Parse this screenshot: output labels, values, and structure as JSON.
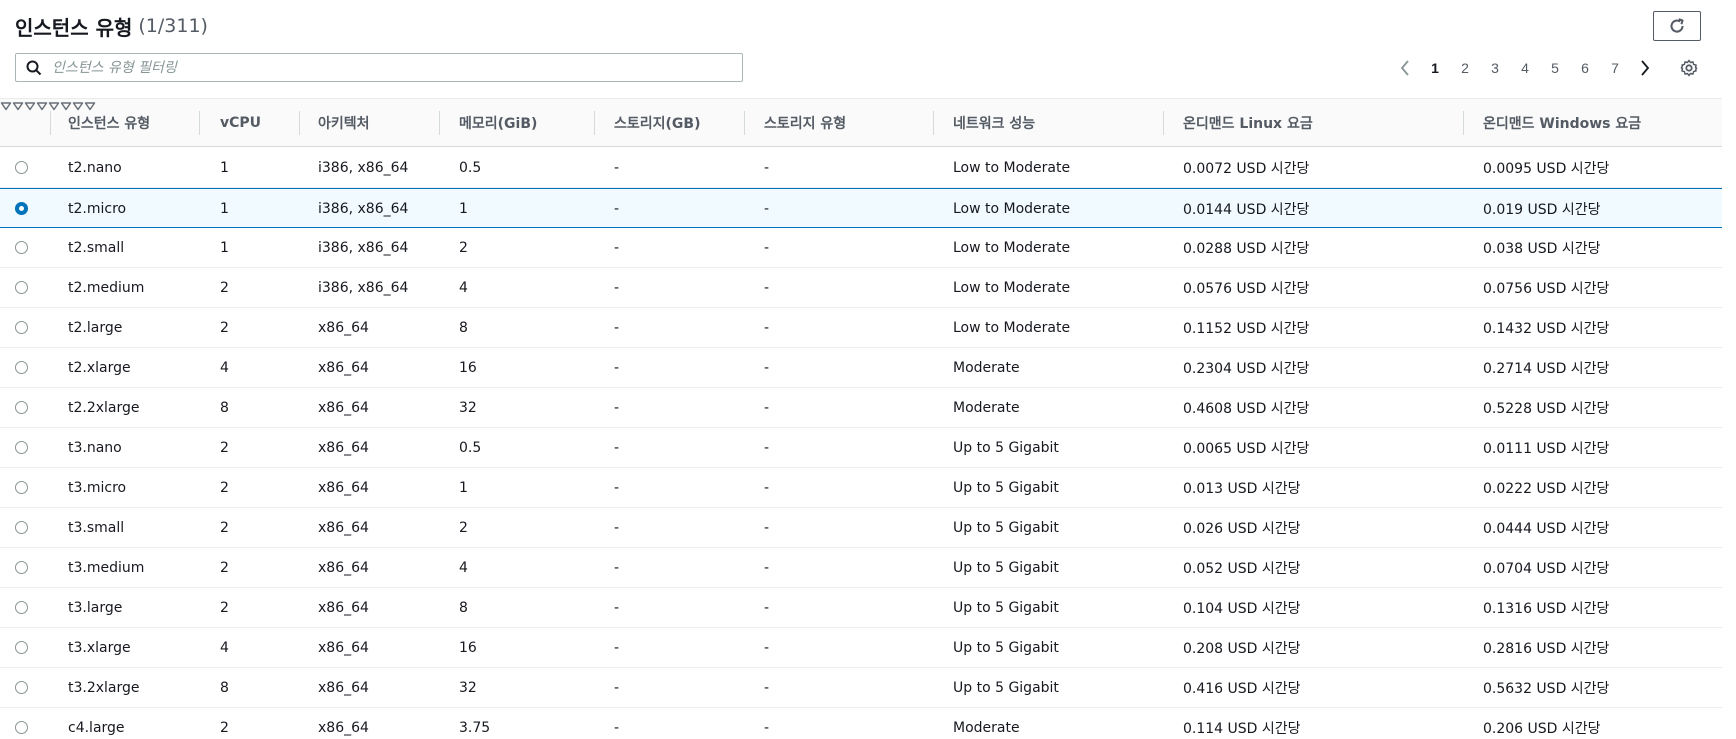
{
  "header": {
    "title": "인스턴스 유형",
    "count": "(1/311)"
  },
  "search": {
    "placeholder": "인스턴스 유형 필터링",
    "value": ""
  },
  "pagination": {
    "pages": [
      "1",
      "2",
      "3",
      "4",
      "5",
      "6",
      "7"
    ],
    "current": "1"
  },
  "icons": {
    "refresh": "refresh-icon",
    "search": "search-icon",
    "prev": "chevron-left-icon",
    "next": "chevron-right-icon",
    "settings": "gear-icon",
    "sort": "sort-down-icon"
  },
  "colors": {
    "accent": "#0073bb",
    "selected_row_bg": "#f1faff",
    "header_bg": "#fafafa"
  },
  "table": {
    "columns": [
      {
        "key": "type",
        "label": "인스턴스 유형"
      },
      {
        "key": "vcpu",
        "label": "vCPU"
      },
      {
        "key": "arch",
        "label": "아키텍처"
      },
      {
        "key": "mem",
        "label": "메모리(GiB)"
      },
      {
        "key": "storage",
        "label": "스토리지(GB)"
      },
      {
        "key": "storage_type",
        "label": "스토리지 유형"
      },
      {
        "key": "network",
        "label": "네트워크 성능"
      },
      {
        "key": "linux",
        "label": "온디맨드 Linux 요금"
      },
      {
        "key": "windows",
        "label": "온디맨드 Windows 요금"
      }
    ],
    "selected_index": 1,
    "rows": [
      {
        "type": "t2.nano",
        "vcpu": "1",
        "arch": "i386, x86_64",
        "mem": "0.5",
        "storage": "-",
        "storage_type": "-",
        "network": "Low to Moderate",
        "linux": "0.0072 USD 시간당",
        "windows": "0.0095 USD 시간당"
      },
      {
        "type": "t2.micro",
        "vcpu": "1",
        "arch": "i386, x86_64",
        "mem": "1",
        "storage": "-",
        "storage_type": "-",
        "network": "Low to Moderate",
        "linux": "0.0144 USD 시간당",
        "windows": "0.019 USD 시간당"
      },
      {
        "type": "t2.small",
        "vcpu": "1",
        "arch": "i386, x86_64",
        "mem": "2",
        "storage": "-",
        "storage_type": "-",
        "network": "Low to Moderate",
        "linux": "0.0288 USD 시간당",
        "windows": "0.038 USD 시간당"
      },
      {
        "type": "t2.medium",
        "vcpu": "2",
        "arch": "i386, x86_64",
        "mem": "4",
        "storage": "-",
        "storage_type": "-",
        "network": "Low to Moderate",
        "linux": "0.0576 USD 시간당",
        "windows": "0.0756 USD 시간당"
      },
      {
        "type": "t2.large",
        "vcpu": "2",
        "arch": "x86_64",
        "mem": "8",
        "storage": "-",
        "storage_type": "-",
        "network": "Low to Moderate",
        "linux": "0.1152 USD 시간당",
        "windows": "0.1432 USD 시간당"
      },
      {
        "type": "t2.xlarge",
        "vcpu": "4",
        "arch": "x86_64",
        "mem": "16",
        "storage": "-",
        "storage_type": "-",
        "network": "Moderate",
        "linux": "0.2304 USD 시간당",
        "windows": "0.2714 USD 시간당"
      },
      {
        "type": "t2.2xlarge",
        "vcpu": "8",
        "arch": "x86_64",
        "mem": "32",
        "storage": "-",
        "storage_type": "-",
        "network": "Moderate",
        "linux": "0.4608 USD 시간당",
        "windows": "0.5228 USD 시간당"
      },
      {
        "type": "t3.nano",
        "vcpu": "2",
        "arch": "x86_64",
        "mem": "0.5",
        "storage": "-",
        "storage_type": "-",
        "network": "Up to 5 Gigabit",
        "linux": "0.0065 USD 시간당",
        "windows": "0.0111 USD 시간당"
      },
      {
        "type": "t3.micro",
        "vcpu": "2",
        "arch": "x86_64",
        "mem": "1",
        "storage": "-",
        "storage_type": "-",
        "network": "Up to 5 Gigabit",
        "linux": "0.013 USD 시간당",
        "windows": "0.0222 USD 시간당"
      },
      {
        "type": "t3.small",
        "vcpu": "2",
        "arch": "x86_64",
        "mem": "2",
        "storage": "-",
        "storage_type": "-",
        "network": "Up to 5 Gigabit",
        "linux": "0.026 USD 시간당",
        "windows": "0.0444 USD 시간당"
      },
      {
        "type": "t3.medium",
        "vcpu": "2",
        "arch": "x86_64",
        "mem": "4",
        "storage": "-",
        "storage_type": "-",
        "network": "Up to 5 Gigabit",
        "linux": "0.052 USD 시간당",
        "windows": "0.0704 USD 시간당"
      },
      {
        "type": "t3.large",
        "vcpu": "2",
        "arch": "x86_64",
        "mem": "8",
        "storage": "-",
        "storage_type": "-",
        "network": "Up to 5 Gigabit",
        "linux": "0.104 USD 시간당",
        "windows": "0.1316 USD 시간당"
      },
      {
        "type": "t3.xlarge",
        "vcpu": "4",
        "arch": "x86_64",
        "mem": "16",
        "storage": "-",
        "storage_type": "-",
        "network": "Up to 5 Gigabit",
        "linux": "0.208 USD 시간당",
        "windows": "0.2816 USD 시간당"
      },
      {
        "type": "t3.2xlarge",
        "vcpu": "8",
        "arch": "x86_64",
        "mem": "32",
        "storage": "-",
        "storage_type": "-",
        "network": "Up to 5 Gigabit",
        "linux": "0.416 USD 시간당",
        "windows": "0.5632 USD 시간당"
      },
      {
        "type": "c4.large",
        "vcpu": "2",
        "arch": "x86_64",
        "mem": "3.75",
        "storage": "-",
        "storage_type": "-",
        "network": "Moderate",
        "linux": "0.114 USD 시간당",
        "windows": "0.206 USD 시간당"
      }
    ]
  }
}
